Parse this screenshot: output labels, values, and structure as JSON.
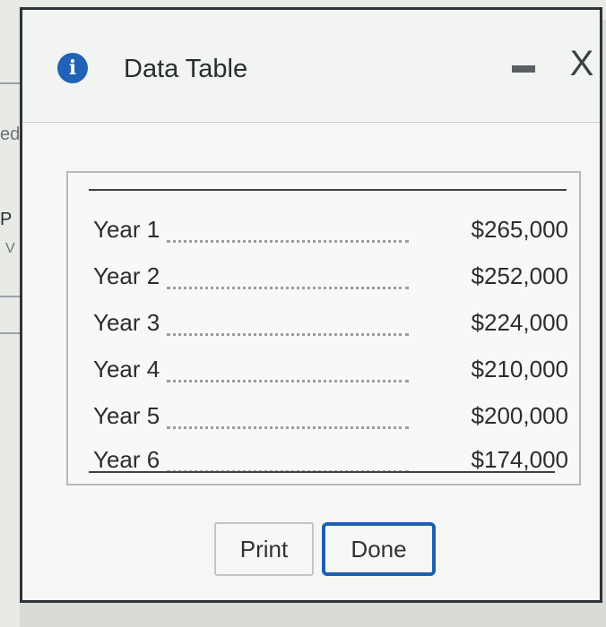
{
  "dialog": {
    "title": "Data Table",
    "close_symbol": "X",
    "info_symbol": "i"
  },
  "table": {
    "rows": [
      {
        "label": "Year 1",
        "value": "$265,000"
      },
      {
        "label": "Year 2",
        "value": "$252,000"
      },
      {
        "label": "Year 3",
        "value": "$224,000"
      },
      {
        "label": "Year 4",
        "value": "$210,000"
      },
      {
        "label": "Year 5",
        "value": "$200,000"
      },
      {
        "label": "Year 6",
        "value": "$174,000"
      }
    ]
  },
  "buttons": {
    "print_label": "Print",
    "done_label": "Done"
  },
  "background_fragments": {
    "frag1": "ed",
    "frag2": "P",
    "frag3": "V"
  },
  "colors": {
    "accent": "#1c5fb0",
    "info_icon": "#1f62b7"
  }
}
